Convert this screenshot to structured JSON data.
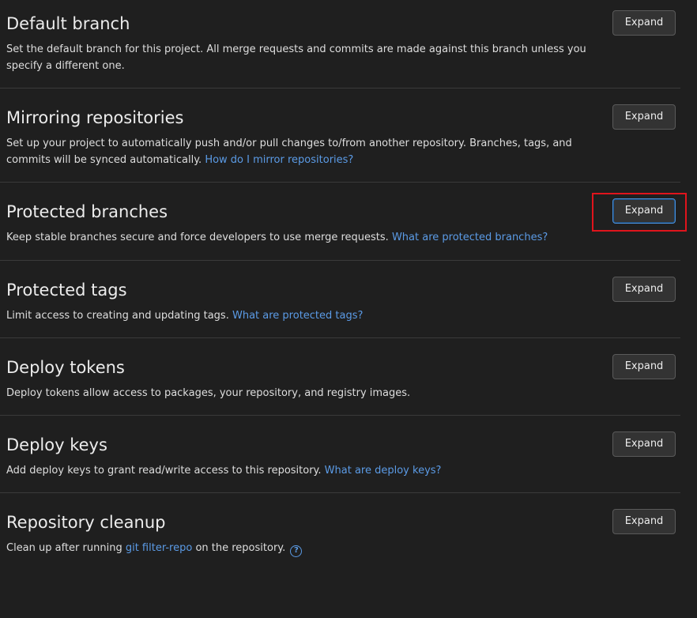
{
  "sections": [
    {
      "title": "Default branch",
      "description": "Set the default branch for this project. All merge requests and commits are made against this branch unless you specify a different one.",
      "expand_label": "Expand"
    },
    {
      "title": "Mirroring repositories",
      "description": "Set up your project to automatically push and/or pull changes to/from another repository. Branches, tags, and commits will be synced automatically.",
      "link_text": "How do I mirror repositories?",
      "expand_label": "Expand"
    },
    {
      "title": "Protected branches",
      "description": "Keep stable branches secure and force developers to use merge requests.",
      "link_text": "What are protected branches?",
      "expand_label": "Expand"
    },
    {
      "title": "Protected tags",
      "description": "Limit access to creating and updating tags.",
      "link_text": "What are protected tags?",
      "expand_label": "Expand"
    },
    {
      "title": "Deploy tokens",
      "description": "Deploy tokens allow access to packages, your repository, and registry images.",
      "expand_label": "Expand"
    },
    {
      "title": "Deploy keys",
      "description": "Add deploy keys to grant read/write access to this repository.",
      "link_text": "What are deploy keys?",
      "expand_label": "Expand"
    },
    {
      "title": "Repository cleanup",
      "description_before": "Clean up after running",
      "link_text": "git filter-repo",
      "description_after": "on the repository.",
      "help_icon": "question-circle-icon",
      "expand_label": "Expand"
    }
  ],
  "colors": {
    "background": "#1f1f1f",
    "text": "#ececec",
    "link": "#5b9be6",
    "divider": "#3a3a3a",
    "button_bg": "#333333",
    "highlight": "#e0141c"
  }
}
